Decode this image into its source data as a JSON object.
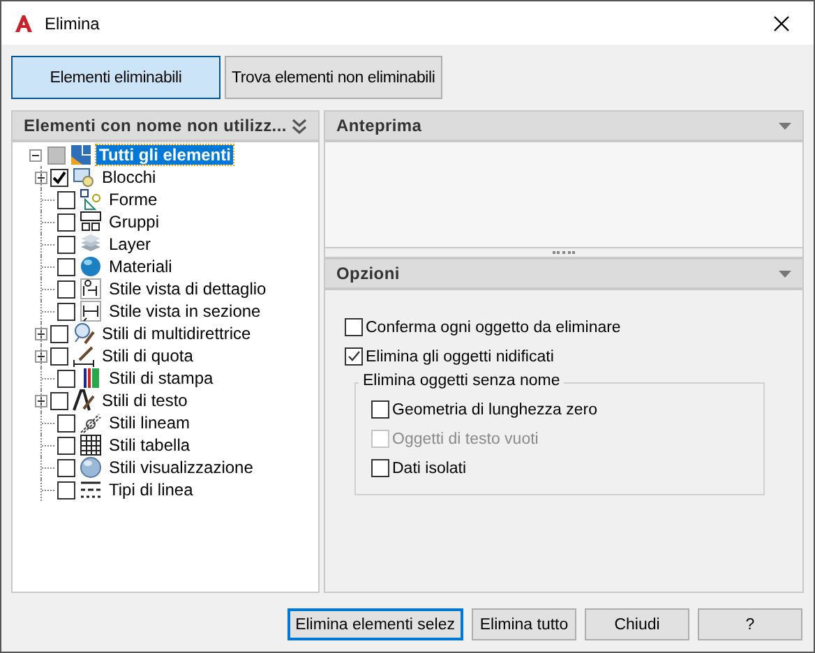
{
  "window": {
    "title": "Elimina"
  },
  "tabs": [
    {
      "label": "Elementi eliminabili",
      "selected": true
    },
    {
      "label": "Trova elementi non eliminabili",
      "selected": false
    }
  ],
  "tree_panel": {
    "title": "Elementi con nome non utilizz...",
    "root": {
      "label": "Tutti gli elementi",
      "selected": true,
      "expanded": true,
      "checked": false,
      "indeterminate": true,
      "children": [
        {
          "label": "Blocchi",
          "checked": true,
          "expandable": true
        },
        {
          "label": "Forme",
          "checked": false,
          "expandable": false
        },
        {
          "label": "Gruppi",
          "checked": false,
          "expandable": false
        },
        {
          "label": "Layer",
          "checked": false,
          "expandable": false
        },
        {
          "label": "Materiali",
          "checked": false,
          "expandable": false
        },
        {
          "label": "Stile vista di dettaglio",
          "checked": false,
          "expandable": false
        },
        {
          "label": "Stile vista in sezione",
          "checked": false,
          "expandable": false
        },
        {
          "label": "Stili di multidirettrice",
          "checked": false,
          "expandable": true
        },
        {
          "label": "Stili di quota",
          "checked": false,
          "expandable": true
        },
        {
          "label": "Stili di stampa",
          "checked": false,
          "expandable": false
        },
        {
          "label": "Stili di testo",
          "checked": false,
          "expandable": true
        },
        {
          "label": "Stili lineam",
          "checked": false,
          "expandable": false
        },
        {
          "label": "Stili tabella",
          "checked": false,
          "expandable": false
        },
        {
          "label": "Stili visualizzazione",
          "checked": false,
          "expandable": false
        },
        {
          "label": "Tipi di linea",
          "checked": false,
          "expandable": false
        }
      ]
    }
  },
  "preview_panel": {
    "title": "Anteprima"
  },
  "options_panel": {
    "title": "Opzioni",
    "options": [
      {
        "label": "Conferma ogni oggetto da eliminare",
        "checked": false,
        "disabled": false
      },
      {
        "label": "Elimina gli oggetti nidificati",
        "checked": true,
        "disabled": false
      }
    ],
    "group": {
      "title": "Elimina oggetti senza nome",
      "options": [
        {
          "label": "Geometria di lunghezza zero",
          "checked": false,
          "disabled": false
        },
        {
          "label": "Oggetti di testo vuoti",
          "checked": false,
          "disabled": true
        },
        {
          "label": "Dati isolati",
          "checked": false,
          "disabled": false
        }
      ]
    }
  },
  "buttons": [
    {
      "label": "Elimina elementi selez",
      "default": true
    },
    {
      "label": "Elimina tutto",
      "default": false
    },
    {
      "label": "Chiudi",
      "default": false
    },
    {
      "label": "?",
      "default": false
    }
  ]
}
